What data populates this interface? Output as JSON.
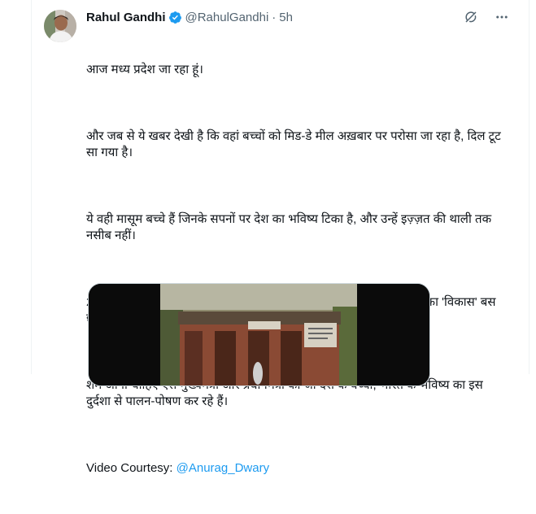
{
  "author": {
    "name": "Rahul Gandhi",
    "handle": "@RahulGandhi",
    "separator": "·",
    "time": "5h"
  },
  "tweet": {
    "p1": "आज मध्य प्रदेश जा रहा हूं।",
    "p2": "और जब से ये खबर देखी है कि वहां बच्चों को मिड-डे मील अख़बार पर परोसा जा रहा है, दिल टूट सा गया है।",
    "p3": "ये वही मासूम बच्चे हैं जिनके सपनों पर देश का भविष्य टिका है, और उन्हें इज़्ज़त की थाली तक नसीब नहीं।",
    "p4": "20 साल से ज़्यादा की BJP सरकार, और बच्चों की थाली तक चुरा ली गई - इनका 'विकास' बस छलावा है, सरकार में आने का असली राज़ तो 'व्यवस्था' है।",
    "p5": "शर्म आनी चाहिए ऐसे मुख्यमंत्री और प्रधानमंत्री को जो देश के बच्चों, भारत के भविष्य का इस दुर्दशा से पालन-पोषण कर रहे हैं।",
    "courtesy_label": "Video Courtesy: ",
    "courtesy_link": "@Anurag_Dwary"
  },
  "icons": [
    "verified-badge-icon",
    "grok-icon",
    "more-options-icon"
  ],
  "colors": {
    "link": "#1d9bf0",
    "verified": "#1d9bf0",
    "muted": "#536471"
  }
}
